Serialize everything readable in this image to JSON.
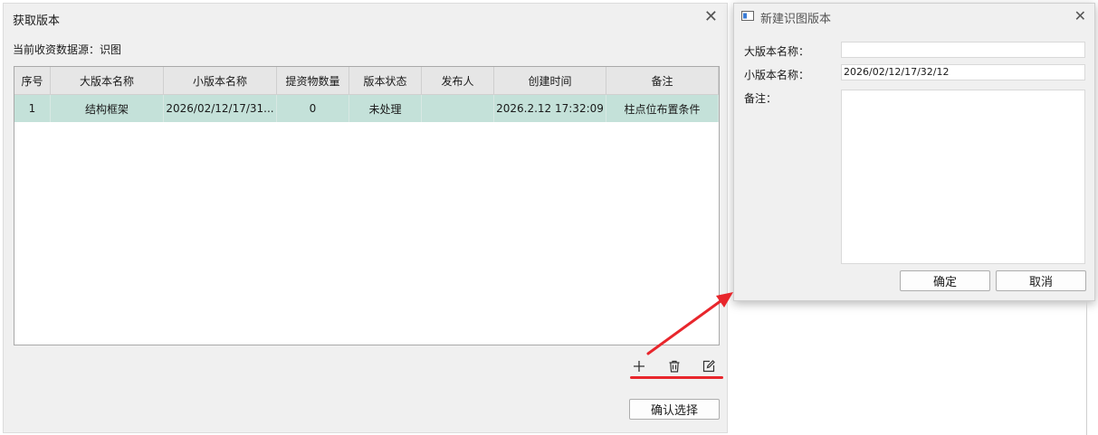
{
  "main_dialog": {
    "title": "获取版本",
    "close_glyph": "✕",
    "source_label": "当前收资数据源：识图",
    "table": {
      "headers": [
        "序号",
        "大版本名称",
        "小版本名称",
        "提资物数量",
        "版本状态",
        "发布人",
        "创建时间",
        "备注"
      ],
      "rows": [
        [
          "1",
          "结构框架",
          "2026/02/12/17/31...",
          "0",
          "未处理",
          "",
          "2026.2.12 17:32:09",
          "柱点位布置条件"
        ]
      ]
    },
    "toolbar_icons": [
      "add-icon",
      "delete-icon",
      "edit-icon"
    ],
    "confirm_select_label": "确认选择"
  },
  "new_version_dialog": {
    "title": "新建识图版本",
    "close_glyph": "✕",
    "major_label": "大版本名称：",
    "major_value": "",
    "minor_label": "小版本名称：",
    "minor_value": "2026/02/12/17/32/12",
    "remark_label": "备注：",
    "remark_value": "",
    "ok_label": "确定",
    "cancel_label": "取消"
  },
  "colors": {
    "selected_row": "#c4e1d9",
    "annotation_red": "#e8262c",
    "dialog_bg": "#f0f0f0"
  }
}
